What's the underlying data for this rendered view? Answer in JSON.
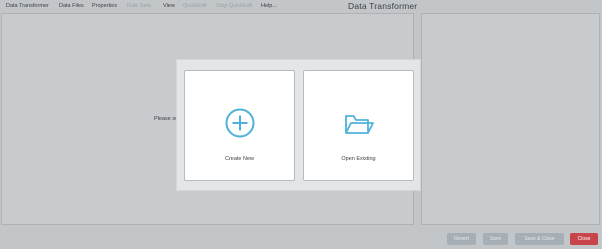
{
  "menu": [
    {
      "label": "Data Transformer",
      "enabled": true
    },
    {
      "label": "Data Files",
      "enabled": true
    },
    {
      "label": "Properties",
      "enabled": true
    },
    {
      "label": "Rule Sets...",
      "enabled": false
    },
    {
      "label": "View",
      "enabled": true
    },
    {
      "label": "QuickEdit",
      "enabled": false
    },
    {
      "label": "Stop QuickEdit",
      "enabled": false
    },
    {
      "label": "Help...",
      "enabled": true
    }
  ],
  "app_title": "Data Transformer",
  "left_panel": {
    "message": "Please se"
  },
  "dialog": {
    "create_label": "Create New",
    "create_icon": "plus-circle-icon",
    "open_label": "Open Existing",
    "open_icon": "folder-open-icon",
    "accent_color": "#4fb3d9"
  },
  "footer": {
    "revert_label": "Revert",
    "save_label": "Save",
    "save_close_label": "Save & Close",
    "close_label": "Close"
  }
}
